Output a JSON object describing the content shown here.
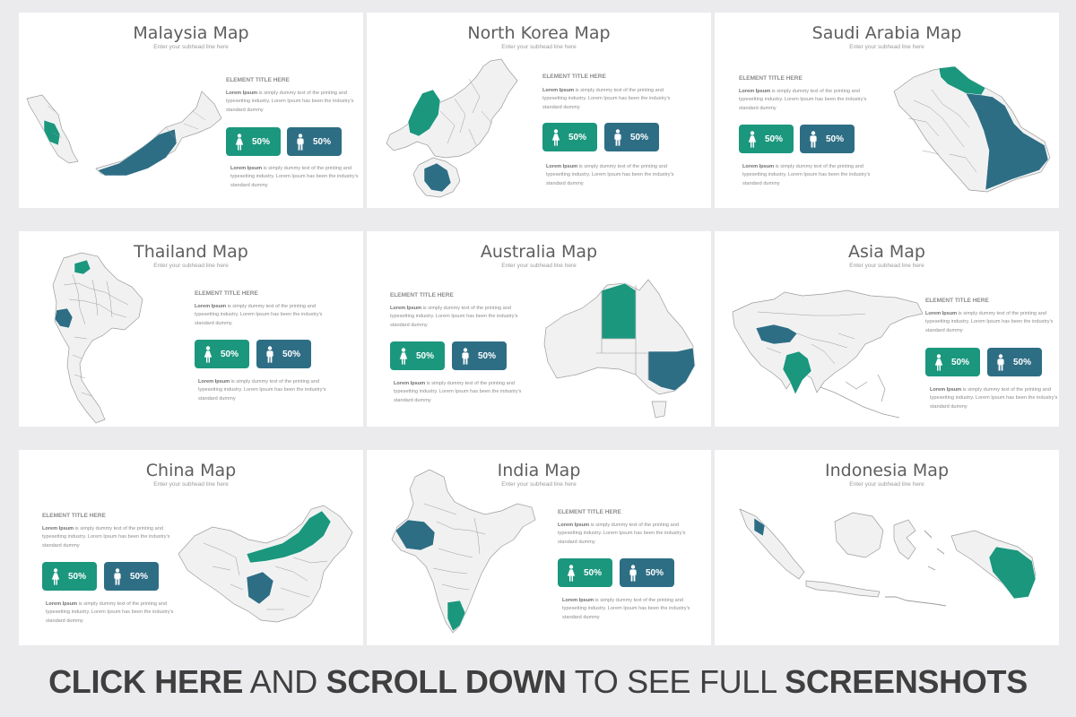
{
  "colors": {
    "teal": "#1b977e",
    "blue": "#2e6e85",
    "land": "#f1f1f1",
    "border": "#9c9c9c"
  },
  "slides": [
    {
      "title": "Malaysia Map",
      "subtitle": "Enter your subhead line here",
      "element_title": "ELEMENT TITLE HERE",
      "lead": "Lorem Ipsum",
      "para1": "is simply dummy text of the printing and typesetting industry. Lorem Ipsum has been the industry's standard dummy",
      "para2": "is simply dummy text of the printing and typesetting industry. Lorem Ipsum has been the industry's standard dummy",
      "female_pct": "50%",
      "male_pct": "50%"
    },
    {
      "title": "North Korea Map",
      "subtitle": "Enter your subhead line here",
      "element_title": "ELEMENT TITLE HERE",
      "lead": "Lorem Ipsum",
      "para1": "is simply dummy text of the printing and typesetting industry. Lorem Ipsum has been the industry's standard dummy",
      "para2": "is simply dummy text of the printing and typesetting industry. Lorem Ipsum has been the industry's standard dummy",
      "female_pct": "50%",
      "male_pct": "50%"
    },
    {
      "title": "Saudi Arabia Map",
      "subtitle": "Enter your subhead line here",
      "element_title": "ELEMENT TITLE HERE",
      "lead": "Lorem Ipsum",
      "para1": "is simply dummy text of the printing and typesetting industry. Lorem Ipsum has been the industry's standard dummy",
      "para2": "is simply dummy text of the printing and typesetting industry. Lorem Ipsum has been the industry's standard dummy",
      "female_pct": "50%",
      "male_pct": "50%"
    },
    {
      "title": "Thailand Map",
      "subtitle": "Enter your subhead line here",
      "element_title": "ELEMENT TITLE HERE",
      "lead": "Lorem Ipsum",
      "para1": "is simply dummy text of the printing and typesetting industry. Lorem Ipsum has been the industry's standard dummy",
      "para2": "is simply dummy text of the printing and typesetting industry. Lorem Ipsum has been the industry's standard dummy",
      "female_pct": "50%",
      "male_pct": "50%"
    },
    {
      "title": "Australia Map",
      "subtitle": "Enter your subhead line here",
      "element_title": "ELEMENT TITLE HERE",
      "lead": "Lorem Ipsum",
      "para1": "is simply dummy text of the printing and typesetting industry. Lorem Ipsum has been the industry's standard dummy",
      "para2": "is simply dummy text of the printing and typesetting industry. Lorem Ipsum has been the industry's standard dummy",
      "female_pct": "50%",
      "male_pct": "50%"
    },
    {
      "title": "Asia Map",
      "subtitle": "Enter your subhead line here",
      "element_title": "ELEMENT TITLE HERE",
      "lead": "Lorem Ipsum",
      "para1": "is simply dummy text of the printing and typesetting industry. Lorem Ipsum has been the industry's standard dummy",
      "para2": "is simply dummy text of the printing and typesetting industry. Lorem Ipsum has been the industry's standard dummy",
      "female_pct": "50%",
      "male_pct": "50%"
    },
    {
      "title": "China Map",
      "subtitle": "Enter your subhead line here",
      "element_title": "ELEMENT TITLE HERE",
      "lead": "Lorem Ipsum",
      "para1": "is simply dummy text of the printing and typesetting industry. Lorem Ipsum has been the industry's standard dummy",
      "para2": "is simply dummy text of the printing and typesetting industry. Lorem Ipsum has been the industry's standard dummy",
      "female_pct": "50%",
      "male_pct": "50%"
    },
    {
      "title": "India Map",
      "subtitle": "Enter your subhead line here",
      "element_title": "ELEMENT TITLE HERE",
      "lead": "Lorem Ipsum",
      "para1": "is simply dummy text of the printing and typesetting industry. Lorem Ipsum has been the industry's standard dummy",
      "para2": "is simply dummy text of the printing and typesetting industry. Lorem Ipsum has been the industry's standard dummy",
      "female_pct": "50%",
      "male_pct": "50%"
    },
    {
      "title": "Indonesia Map",
      "subtitle": "Enter your subhead line here"
    }
  ],
  "banner": {
    "part1": "CLICK HERE",
    "part2": " AND ",
    "part3": "SCROLL DOWN",
    "part4": " TO SEE FULL ",
    "part5": "SCREENSHOTS"
  }
}
